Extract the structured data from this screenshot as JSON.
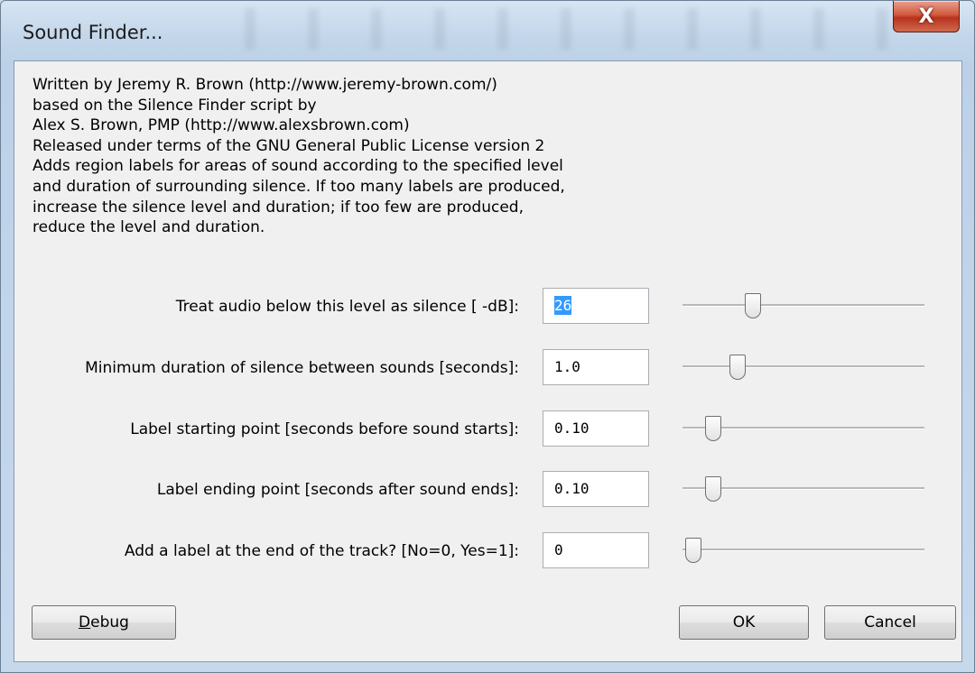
{
  "window": {
    "title": "Sound Finder...",
    "close_label": "X"
  },
  "description": [
    "Written by Jeremy R. Brown (http://www.jeremy-brown.com/)",
    "based on the Silence Finder script by",
    "Alex S. Brown, PMP (http://www.alexsbrown.com)",
    "Released under terms of the GNU General Public License version 2",
    "Adds region labels for areas of sound according to the specified level",
    "and duration of surrounding silence. If too many labels are produced,",
    "increase the silence level and duration; if too few are produced,",
    "reduce the level and duration."
  ],
  "parameters": [
    {
      "label": "Treat audio below this level as silence [ -dB]:",
      "value": "26",
      "selected": true,
      "slider_fraction": 0.27
    },
    {
      "label": "Minimum duration of silence between sounds [seconds]:",
      "value": "1.0",
      "selected": false,
      "slider_fraction": 0.2
    },
    {
      "label": "Label starting point [seconds before sound starts]:",
      "value": "0.10",
      "selected": false,
      "slider_fraction": 0.09
    },
    {
      "label": "Label ending point [seconds after sound ends]:",
      "value": "0.10",
      "selected": false,
      "slider_fraction": 0.09
    },
    {
      "label": "Add a label at the end of the track? [No=0, Yes=1]:",
      "value": "0",
      "selected": false,
      "slider_fraction": 0.0
    }
  ],
  "buttons": {
    "debug": {
      "mnemonic": "D",
      "rest": "ebug"
    },
    "ok": "OK",
    "cancel": "Cancel"
  }
}
